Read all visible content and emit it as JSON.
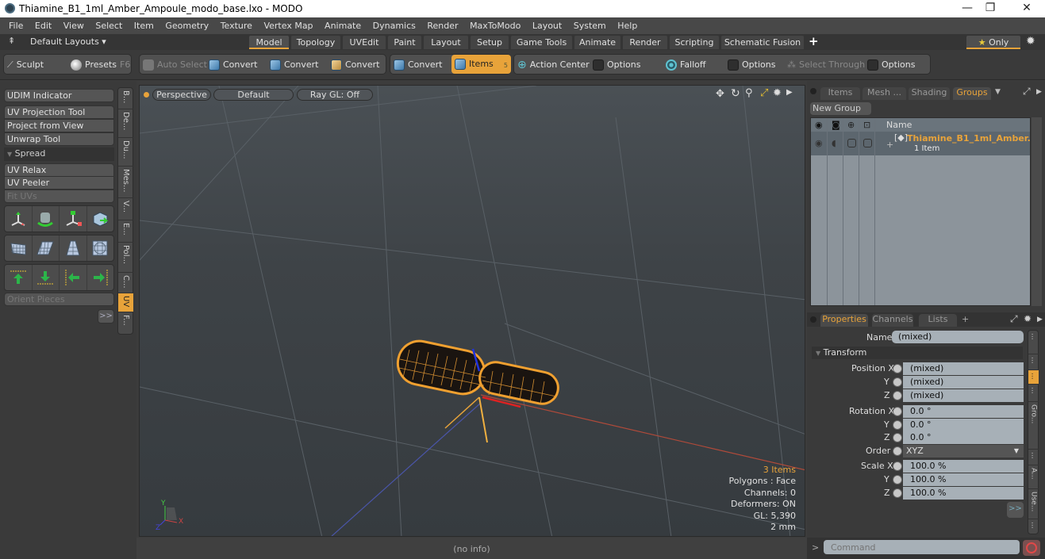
{
  "window": {
    "title": "Thiamine_B1_1ml_Amber_Ampoule_modo_base.lxo - MODO",
    "controls": {
      "minimize": "—",
      "maximize": "❐",
      "close": "✕"
    }
  },
  "menu": [
    "File",
    "Edit",
    "View",
    "Select",
    "Item",
    "Geometry",
    "Texture",
    "Vertex Map",
    "Animate",
    "Dynamics",
    "Render",
    "MaxToModo",
    "Layout",
    "System",
    "Help"
  ],
  "layoutbar": {
    "layouts_label": "Default Layouts ▾",
    "tabs": [
      "Model",
      "Topology",
      "UVEdit",
      "Paint",
      "Layout",
      "Setup",
      "Game Tools",
      "Animate",
      "Render",
      "Scripting",
      "Schematic Fusion"
    ],
    "active_tab": "Model",
    "add": "+",
    "only_label": "Only",
    "star": "★"
  },
  "toolbar": {
    "sculpt": "Sculpt",
    "presets": "Presets",
    "presets_key": "F6",
    "auto_select": "Auto Select",
    "convert1": "Convert",
    "convert2": "Convert",
    "convert3": "Convert",
    "convert4": "Convert",
    "items": "Items",
    "items_count": "5",
    "action_center": "Action Center",
    "options1": "Options",
    "falloff": "Falloff",
    "options2": "Options",
    "select_through": "Select Through",
    "options3": "Options"
  },
  "left_panel": {
    "udim": "UDIM Indicator",
    "uv_projection": "UV Projection Tool",
    "project_view": "Project from View",
    "unwrap": "Unwrap Tool",
    "spread": "Spread",
    "uv_relax": "UV Relax",
    "uv_peeler": "UV Peeler",
    "fit_uvs": "Fit UVs",
    "orient": "Orient Pieces",
    "more": ">>",
    "vtabs": [
      "B...",
      "De...",
      "Du...",
      "Mes...",
      "V...",
      "E...",
      "Pol...",
      "C...",
      "UV",
      "F..."
    ],
    "active_vtab": "UV"
  },
  "viewport": {
    "view": "Perspective",
    "style": "Default",
    "raygl": "Ray GL: Off",
    "stats": {
      "items": "3 Items",
      "polygons": "Polygons : Face",
      "channels": "Channels: 0",
      "deformers": "Deformers: ON",
      "gl": "GL: 5,390",
      "scale": "2 mm"
    },
    "axis_x": "X",
    "axis_y": "Y",
    "axis_z": "Z"
  },
  "status": {
    "info": "(no info)"
  },
  "right_panel": {
    "tabs": [
      "Items",
      "Mesh ...",
      "Shading",
      "Groups"
    ],
    "active_tab": "Groups",
    "new_group": "New Group",
    "col_name": "Name",
    "group_name": "Thiamine_B1_1ml_Amber...",
    "group_count": "1 Item",
    "prop_tabs": [
      "Properties",
      "Channels",
      "Lists"
    ],
    "active_prop_tab": "Properties",
    "prop_add": "+",
    "name_label": "Name",
    "name_value": "(mixed)",
    "transform": "Transform",
    "position_x_label": "Position X",
    "position_x": "(mixed)",
    "position_y": "(mixed)",
    "position_z": "(mixed)",
    "rotation_x_label": "Rotation X",
    "rotation_x": "0.0 °",
    "rotation_y": "0.0 °",
    "rotation_z": "0.0 °",
    "order_label": "Order",
    "order_value": "XYZ",
    "scale_x_label": "Scale X",
    "scale_x": "100.0 %",
    "scale_y": "100.0 %",
    "scale_z": "100.0 %",
    "y_label": "Y",
    "z_label": "Z",
    "more": ">>",
    "side_tabs": [
      "...",
      "...",
      "...",
      "...",
      "Gro...",
      "...",
      "A...",
      "Use...",
      "..."
    ],
    "command_placeholder": "Command",
    "cmd_prompt": ">"
  },
  "colors": {
    "accent": "#e8a33a",
    "wire": "#f0a030"
  }
}
